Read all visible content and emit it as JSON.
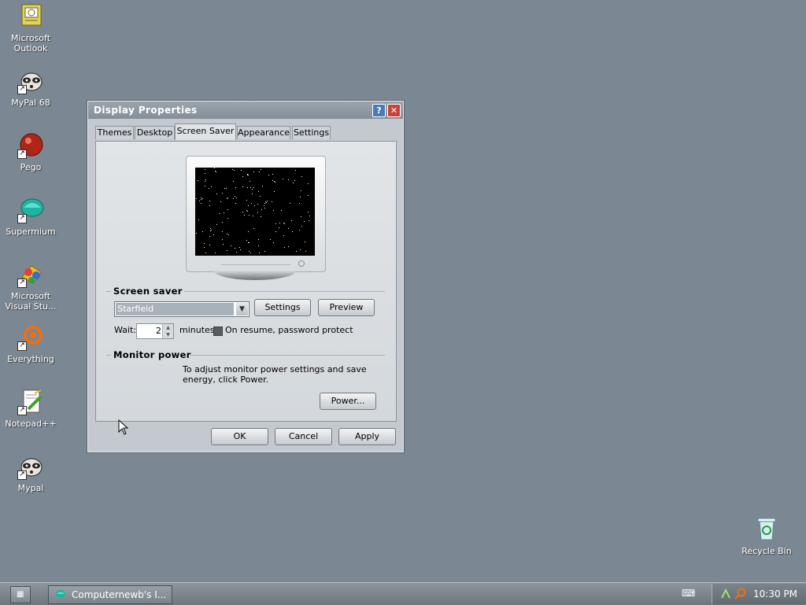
{
  "desktop": {
    "icons": [
      {
        "label": "Microsoft\nOutlook",
        "line1": "Microsoft",
        "line2": "Outlook"
      },
      {
        "line1": "MyPal 68"
      },
      {
        "line1": "Pego"
      },
      {
        "line1": "Supermium"
      },
      {
        "line1": "Microsoft",
        "line2": "Visual Stu..."
      },
      {
        "line1": "Everything"
      },
      {
        "line1": "Notepad++"
      },
      {
        "line1": "Mypal"
      },
      {
        "line1": "Recycle Bin"
      }
    ]
  },
  "dialog": {
    "title": "Display Properties",
    "help_glyph": "?",
    "close_glyph": "✕",
    "tabs": [
      {
        "label": "Themes"
      },
      {
        "label": "Desktop"
      },
      {
        "label": "Screen Saver"
      },
      {
        "label": "Appearance"
      },
      {
        "label": "Settings"
      }
    ],
    "active_tab": "Screen Saver",
    "screen_saver": {
      "group_title": "Screen saver",
      "selected": "Starfield",
      "settings_button": "Settings",
      "preview_button": "Preview",
      "wait_label": "Wait:",
      "wait_value": "2",
      "minutes_label": "minutes",
      "password_label": "On resume, password protect",
      "password_checked": true
    },
    "monitor_power": {
      "group_title": "Monitor power",
      "description": "To adjust monitor power settings and save energy, click Power.",
      "power_button": "Power..."
    },
    "ok_button": "OK",
    "cancel_button": "Cancel",
    "apply_button": "Apply"
  },
  "taskbar": {
    "task_label": "Computernewb's I...",
    "clock": "10:30 PM"
  },
  "colors": {
    "desktop": "#7b8792",
    "dialog_bg": "#c3c9cf",
    "title_bar": "#8f99a3",
    "close_button": "#c8423a",
    "help_button": "#4c79b8",
    "selected_item": "#a8b2bb"
  }
}
